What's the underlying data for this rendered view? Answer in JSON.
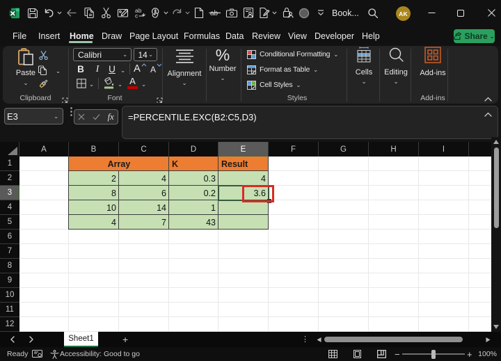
{
  "titlebar": {
    "title": "Book...",
    "avatar_initials": "AK",
    "qat": [
      "excel-logo",
      "save",
      "undo",
      "back",
      "copy",
      "cut",
      "paste-picture",
      "replace",
      "touch-mode",
      "redo",
      "new-file",
      "strikethrough",
      "camera",
      "form",
      "draw-page",
      "lock-person",
      "record-circle",
      "qat-more"
    ],
    "window_controls": [
      "minimize",
      "maximize",
      "close"
    ]
  },
  "menu": {
    "items": [
      {
        "label": "File",
        "active": false
      },
      {
        "label": "Insert",
        "active": false
      },
      {
        "label": "Home",
        "active": true
      },
      {
        "label": "Draw",
        "active": false
      },
      {
        "label": "Page Layout",
        "active": false
      },
      {
        "label": "Formulas",
        "active": false
      },
      {
        "label": "Data",
        "active": false
      },
      {
        "label": "Review",
        "active": false
      },
      {
        "label": "View",
        "active": false
      },
      {
        "label": "Developer",
        "active": false
      },
      {
        "label": "Help",
        "active": false
      }
    ],
    "share_label": "Share"
  },
  "ribbon": {
    "clipboard": {
      "group_label": "Clipboard",
      "paste_label": "Paste"
    },
    "font": {
      "group_label": "Font",
      "font_name": "Calibri",
      "font_size": "14",
      "bold": "B",
      "italic": "I",
      "underline": "U",
      "grow_letter": "A",
      "shrink_letter": "A",
      "color_letter": "A"
    },
    "alignment": {
      "label": "Alignment"
    },
    "number": {
      "label": "Number"
    },
    "styles": {
      "group_label": "Styles",
      "items": [
        "Conditional Formatting",
        "Format as Table",
        "Cell Styles"
      ]
    },
    "cells": {
      "label": "Cells"
    },
    "editing": {
      "label": "Editing"
    },
    "addins": {
      "label": "Add-ins",
      "group_label": "Add-ins"
    }
  },
  "formula_bar": {
    "name_box": "E3",
    "fx_label": "fx",
    "formula": "=PERCENTILE.EXC(B2:C5,D3)"
  },
  "sheet": {
    "column_letters": [
      "A",
      "B",
      "C",
      "D",
      "E",
      "F",
      "G",
      "H",
      "I"
    ],
    "row_numbers": [
      1,
      2,
      3,
      4,
      5,
      6,
      7,
      8,
      9,
      10,
      11,
      12
    ],
    "selected_cell": "E3",
    "selected_column": "E",
    "selected_row": 3,
    "table": {
      "headers": {
        "array": "Array",
        "k": "K",
        "result": "Result"
      },
      "rows": [
        {
          "b": "2",
          "c": "4",
          "d": "0.3",
          "e": "4"
        },
        {
          "b": "8",
          "c": "6",
          "d": "0.2",
          "e": "3.6"
        },
        {
          "b": "10",
          "c": "14",
          "d": "1",
          "e": ""
        },
        {
          "b": "4",
          "c": "7",
          "d": "43",
          "e": ""
        }
      ]
    },
    "colors": {
      "header_fill": "#ED7D31",
      "data_fill": "#C6E0B4",
      "annotation_red": "#da2a23",
      "selection_green": "#35593c"
    }
  },
  "tabbar": {
    "sheet_name": "Sheet1",
    "add_label": "+"
  },
  "statusbar": {
    "ready": "Ready",
    "accessibility": "Accessibility: Good to go",
    "zoom": "100%",
    "zoom_out": "−",
    "zoom_in": "+"
  }
}
